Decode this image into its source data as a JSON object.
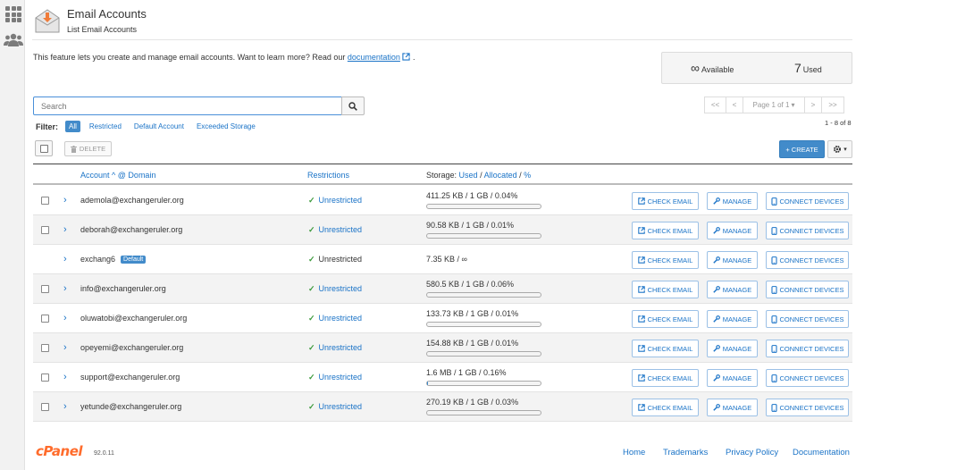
{
  "header": {
    "title": "Email Accounts",
    "subtitle": "List Email Accounts"
  },
  "intro": {
    "text": "This feature lets you create and manage email accounts. Want to learn more? Read our ",
    "link": "documentation",
    "after": "."
  },
  "stats": {
    "available_value": "∞",
    "available_label": "Available",
    "used_value": "7",
    "used_label": "Used"
  },
  "search": {
    "placeholder": "Search"
  },
  "filter": {
    "label": "Filter:",
    "options": [
      "All",
      "Restricted",
      "Default Account",
      "Exceeded Storage"
    ],
    "selected": "All"
  },
  "pagination": {
    "first": "<<",
    "prev": "<",
    "page": "Page 1 of 1",
    "next": ">",
    "last": ">>",
    "range": "1 - 8 of 8"
  },
  "toolbar": {
    "delete": "DELETE",
    "create": "+ CREATE"
  },
  "table": {
    "col_account": "Account",
    "col_domain": "@ Domain",
    "col_restrictions": "Restrictions",
    "storage_prefix": "Storage:",
    "storage_used": "Used",
    "storage_allocated": "Allocated",
    "storage_percent": "%",
    "btn_check": "CHECK EMAIL",
    "btn_manage": "MANAGE",
    "btn_connect": "CONNECT DEVICES",
    "rows": [
      {
        "account": "ademola@exchangeruler.org",
        "restriction": "Unrestricted",
        "usage": "411.25 KB / 1 GB / 0.04%",
        "percent": 0.04
      },
      {
        "account": "deborah@exchangeruler.org",
        "restriction": "Unrestricted",
        "usage": "90.58 KB / 1 GB / 0.01%",
        "percent": 0.01
      },
      {
        "account": "exchang6",
        "badge": "Default",
        "restriction": "Unrestricted",
        "usage": "7.35 KB / ∞"
      },
      {
        "account": "info@exchangeruler.org",
        "restriction": "Unrestricted",
        "usage": "580.5 KB / 1 GB / 0.06%",
        "percent": 0.06
      },
      {
        "account": "oluwatobi@exchangeruler.org",
        "restriction": "Unrestricted",
        "usage": "133.73 KB / 1 GB / 0.01%",
        "percent": 0.01
      },
      {
        "account": "opeyemi@exchangeruler.org",
        "restriction": "Unrestricted",
        "usage": "154.88 KB / 1 GB / 0.01%",
        "percent": 0.01
      },
      {
        "account": "support@exchangeruler.org",
        "restriction": "Unrestricted",
        "usage": "1.6 MB / 1 GB / 0.16%",
        "percent": 0.16
      },
      {
        "account": "yetunde@exchangeruler.org",
        "restriction": "Unrestricted",
        "usage": "270.19 KB / 1 GB / 0.03%",
        "percent": 0.03
      }
    ]
  },
  "footer": {
    "logo": "cPanel",
    "version": "92.0.11",
    "links": [
      "Home",
      "Trademarks",
      "Privacy Policy",
      "Documentation"
    ]
  },
  "colors": {
    "accent": "#428bca",
    "link": "#1a73c7",
    "brand": "#ff6c2c",
    "ok": "#3c9a3c"
  },
  "icons": [
    "apps-grid-icon",
    "users-icon",
    "envelope-icon",
    "search-icon",
    "external-link-icon",
    "trash-icon",
    "gear-icon",
    "chevron-right-icon",
    "check-icon",
    "edit-icon",
    "wrench-icon",
    "mobile-icon"
  ]
}
